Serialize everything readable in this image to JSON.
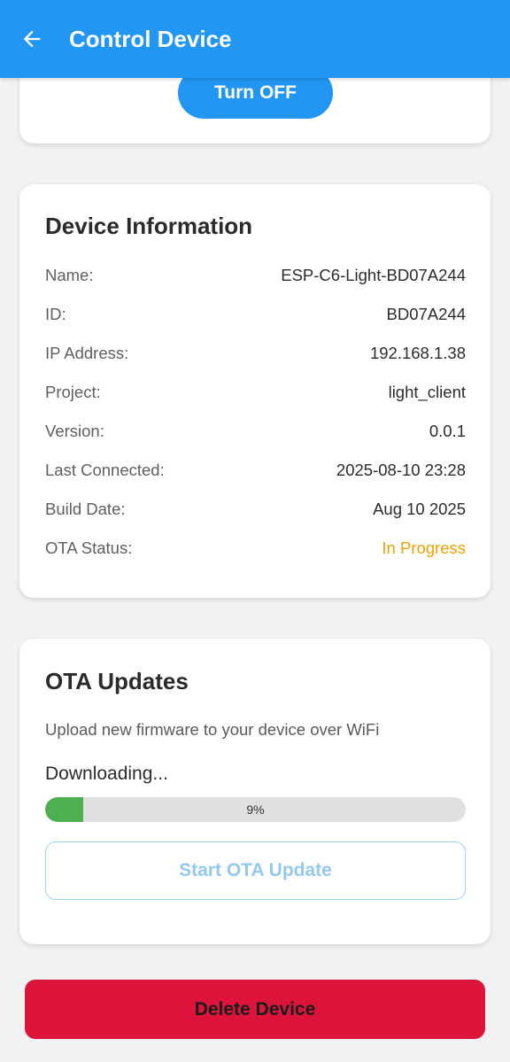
{
  "colors": {
    "primary": "#2196f3",
    "success": "#4caf50",
    "warning": "#f0a000",
    "danger": "#dc143c"
  },
  "app_bar": {
    "back_icon": "arrow-left-icon",
    "title": "Control Device"
  },
  "power": {
    "button_label": "Turn OFF"
  },
  "device_info": {
    "title": "Device Information",
    "rows": [
      {
        "label": "Name:",
        "value": "ESP-C6-Light-BD07A244"
      },
      {
        "label": "ID:",
        "value": "BD07A244"
      },
      {
        "label": "IP Address:",
        "value": "192.168.1.38"
      },
      {
        "label": "Project:",
        "value": "light_client"
      },
      {
        "label": "Version:",
        "value": "0.0.1"
      },
      {
        "label": "Last Connected:",
        "value": "2025-08-10 23:28"
      },
      {
        "label": "Build Date:",
        "value": "Aug 10 2025"
      },
      {
        "label": "OTA Status:",
        "value": "In Progress"
      }
    ]
  },
  "ota": {
    "title": "OTA Updates",
    "description": "Upload new firmware to your device over WiFi",
    "state": "Downloading...",
    "progress_percent": 9,
    "progress_label": "9%",
    "button_label": "Start OTA Update"
  },
  "delete": {
    "button_label": "Delete Device"
  }
}
